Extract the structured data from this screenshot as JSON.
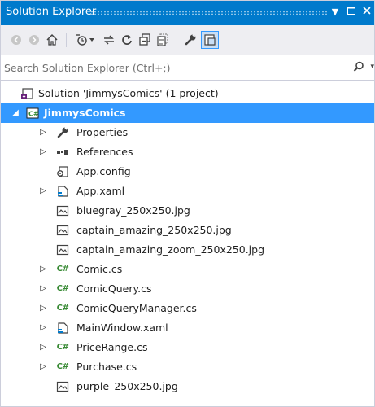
{
  "window": {
    "title": "Solution Explorer"
  },
  "search": {
    "placeholder": "Search Solution Explorer (Ctrl+;)"
  },
  "tree": {
    "solution": "Solution 'JimmysComics' (1 project)",
    "project": "JimmysComics",
    "items": [
      {
        "label": "Properties"
      },
      {
        "label": "References"
      },
      {
        "label": "App.config"
      },
      {
        "label": "App.xaml"
      },
      {
        "label": "bluegray_250x250.jpg"
      },
      {
        "label": "captain_amazing_250x250.jpg"
      },
      {
        "label": "captain_amazing_zoom_250x250.jpg"
      },
      {
        "label": "Comic.cs"
      },
      {
        "label": "ComicQuery.cs"
      },
      {
        "label": "ComicQueryManager.cs"
      },
      {
        "label": "MainWindow.xaml"
      },
      {
        "label": "PriceRange.cs"
      },
      {
        "label": "Purchase.cs"
      },
      {
        "label": "purple_250x250.jpg"
      }
    ],
    "csharp_badge": "C#"
  },
  "colors": {
    "accent": "#007acc",
    "selection": "#3399ff",
    "toolbar": "#eeeef2",
    "csharp": "#388a34"
  }
}
